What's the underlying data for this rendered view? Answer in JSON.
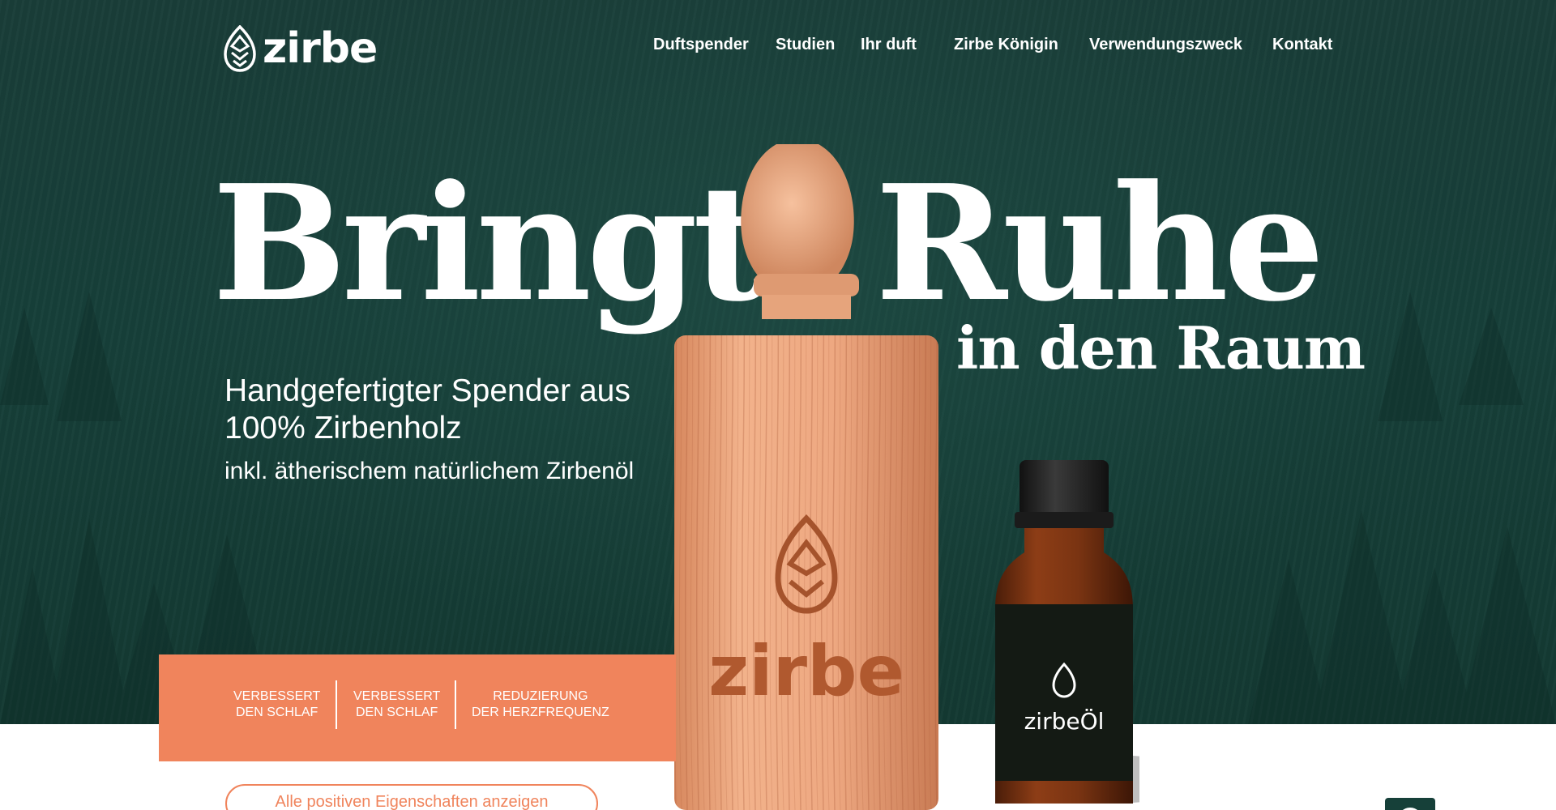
{
  "brand": {
    "name": "zirbe"
  },
  "nav": {
    "items": [
      "Duftspender",
      "Studien",
      "Ihr duft",
      "Zirbe Königin",
      "Verwendungszweck",
      "Kontakt"
    ]
  },
  "hero": {
    "headline_word1": "Bringt",
    "headline_word2": "Ruhe",
    "headline_sub": "in den Raum",
    "subtitle": "Handgefertigter Spender aus 100% Zirbenholz",
    "subtitle2": "inkl. ätherischem natürlichem Zirbenöl"
  },
  "products": {
    "dispenser_engraving": "zirbe",
    "bottle_label": "zirbeÖl"
  },
  "benefits": [
    {
      "line1": "VERBESSERT",
      "line2": "DEN SCHLAF"
    },
    {
      "line1": "VERBESSERT",
      "line2": "DEN SCHLAF"
    },
    {
      "line1": "REDUZIERUNG",
      "line2": "DER HERZFREQUENZ"
    }
  ],
  "cta": {
    "label": "Alle positiven Eigenschaften anzeigen"
  },
  "colors": {
    "hero_background": "#17403a",
    "accent_orange": "#f0845c",
    "wood": "#e8a57f",
    "bottle_amber": "#7a3412"
  },
  "icons": [
    "pine-cone-logo-icon",
    "chat-icon"
  ]
}
